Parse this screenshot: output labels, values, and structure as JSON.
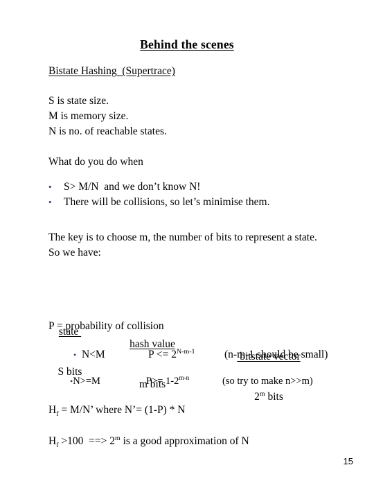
{
  "slide": {
    "title": "Behind the scenes",
    "section_heading": "Bistate Hashing  (Supertrace)",
    "definitions": [
      "S is state size.",
      "M is memory size.",
      "N is no. of reachable states."
    ],
    "question": "What do you do when",
    "bullets": [
      "S> M/N  and we don’t know N!",
      "There will be collisions, so let’s minimise them."
    ],
    "key_lines": [
      "The key is to choose m, the number of bits to represent a state.",
      "So we have:"
    ],
    "table": {
      "headers": [
        "state ",
        "hash value",
        " bitstate vector"
      ],
      "rows": [
        {
          "state": "S bits",
          "hash_base": "m bits",
          "bitstate_base": "2",
          "bitstate_sup": "m",
          "bitstate_tail": " bits"
        }
      ]
    },
    "probability_label": "P = probability of collision",
    "cases": [
      {
        "condition": "N<M",
        "formula_base": "P <= 2",
        "formula_sup": "N-m-1",
        "note": "(n-m-1 should be small)"
      },
      {
        "condition": "N>=M",
        "formula_base": "P>= 1-2",
        "formula_sup": "m-n",
        "note": "(so try to make n>>m)"
      }
    ],
    "formulas": [
      {
        "lead": "H",
        "lead_sub": "f",
        "rest": " = M/N’ where N’= (1-P) * N"
      },
      {
        "lead": "H",
        "lead_sub": "f",
        "rest_a": " >100  ==> 2",
        "rest_sup": "m",
        "rest_b": " is a good approximation of N"
      }
    ],
    "bullet_glyph": "•",
    "page_number": "15",
    "colors": {
      "text": "#000000",
      "bullet": "#333366",
      "background": "#ffffff"
    }
  }
}
